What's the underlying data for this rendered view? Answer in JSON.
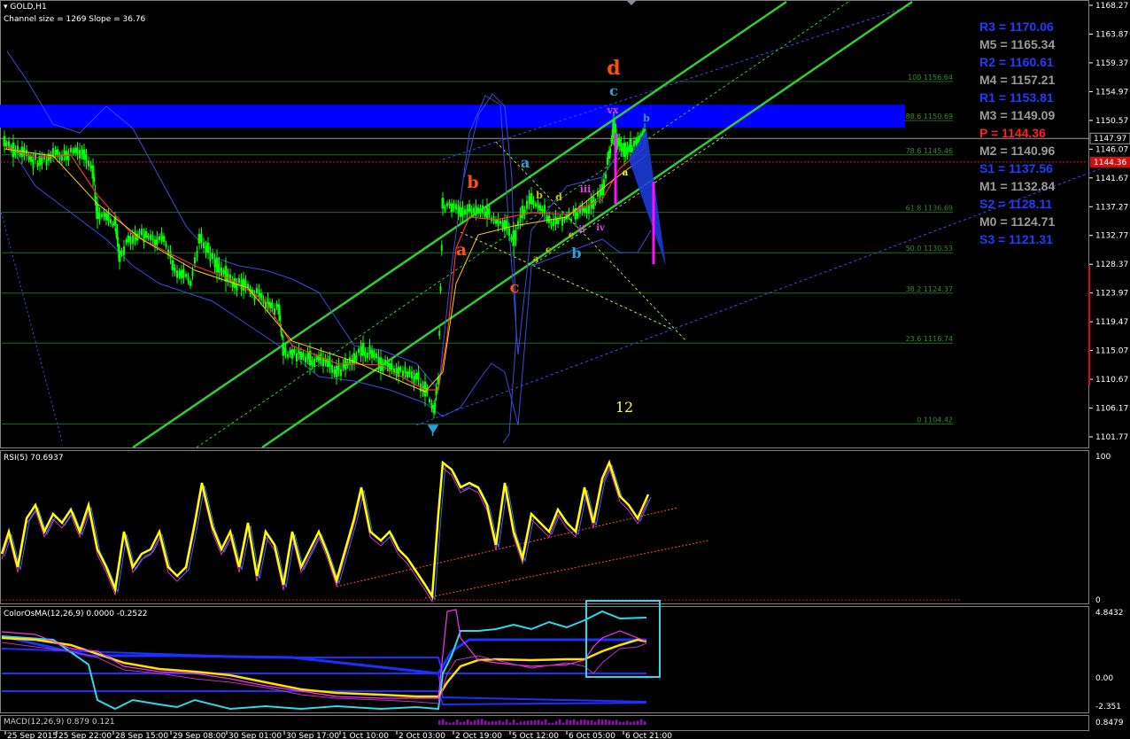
{
  "main_pane": {
    "title": "GOLD,H1",
    "subtitle": "Channel size = 1269 Slope = 36.76",
    "price_axis": [
      "1168.27",
      "1163.87",
      "1159.37",
      "1154.97",
      "1150.57",
      "1146.07",
      "1141.67",
      "1137.27",
      "1132.77",
      "1128.37",
      "1123.97",
      "1119.47",
      "1115.07",
      "1110.67",
      "1106.17",
      "1101.77"
    ],
    "current_price_tag": "1147.97",
    "red_price_tag": "1144.36",
    "pivots": [
      {
        "label": "R3 = 1170.06",
        "color": "#1f3cff"
      },
      {
        "label": "M5 = 1165.34",
        "color": "#9a9a9a"
      },
      {
        "label": "R2 = 1160.61",
        "color": "#1f3cff"
      },
      {
        "label": "M4 = 1157.21",
        "color": "#9a9a9a"
      },
      {
        "label": "R1 = 1153.81",
        "color": "#1f3cff"
      },
      {
        "label": "M3 = 1149.09",
        "color": "#9a9a9a"
      },
      {
        "label": "P  = 1144.36",
        "color": "#ff2020"
      },
      {
        "label": "M2 = 1140.96",
        "color": "#9a9a9a"
      },
      {
        "label": "S1 = 1137.56",
        "color": "#1f3cff"
      },
      {
        "label": "M1 = 1132.84",
        "color": "#9a9a9a"
      },
      {
        "label": "S2 = 1128.11",
        "color": "#1f3cff"
      },
      {
        "label": "M0 = 1124.71",
        "color": "#9a9a9a"
      },
      {
        "label": "S3 = 1121.31",
        "color": "#1f3cff"
      }
    ],
    "fib_levels": [
      "100 1156.64",
      "88.6 1150.69",
      "78.6 1145.46",
      "61.8 1136.69",
      "50.0 1130.53",
      "38.2 1124.37",
      "23.6 1116.74",
      "0 1104.42"
    ],
    "wave_labels": [
      {
        "text": "d",
        "color": "#ff5010"
      },
      {
        "text": "c",
        "color": "#28a0e0"
      },
      {
        "text": "vx",
        "color": "#e040e0"
      },
      {
        "text": "b",
        "color": "#28a0e0"
      },
      {
        "text": "a",
        "color": "#28a0e0"
      },
      {
        "text": "b",
        "color": "#ff5010"
      },
      {
        "text": "b",
        "color": "#c8c800"
      },
      {
        "text": "d",
        "color": "#c8c800"
      },
      {
        "text": "iii",
        "color": "#e040e0"
      },
      {
        "text": "i",
        "color": "#e040e0"
      },
      {
        "text": "a",
        "color": "#ff5010"
      },
      {
        "text": "c",
        "color": "#ff5010"
      },
      {
        "text": "a",
        "color": "#c8c800"
      },
      {
        "text": "c",
        "color": "#c8c800"
      },
      {
        "text": "e",
        "color": "#c8c800"
      },
      {
        "text": "ii",
        "color": "#e040e0"
      },
      {
        "text": "iv",
        "color": "#e040e0"
      },
      {
        "text": "b",
        "color": "#28a0e0"
      },
      {
        "text": "a",
        "color": "#ffff40"
      }
    ],
    "count_label": "12"
  },
  "rsi_pane": {
    "title": "RSI(5) 70.6937",
    "axis": [
      "100",
      "0"
    ]
  },
  "osma_pane": {
    "title": "ColorOsMA(12,26,9) 0.0000 -0.2522",
    "axis": [
      "4.8432",
      "0.00",
      "-2.351"
    ]
  },
  "macd_pane": {
    "title": "MACD(12,26,9) 0.879 0.121",
    "axis": [
      "0.8479"
    ]
  },
  "time_axis": [
    "25 Sep 2015",
    "25 Sep 22:00",
    "28 Sep 15:00",
    "29 Sep 08:00",
    "30 Sep 01:00",
    "30 Sep 17:00",
    "1 Oct 10:00",
    "2 Oct 03:00",
    "2 Oct 19:00",
    "5 Oct 12:00",
    "6 Oct 05:00",
    "6 Oct 21:00"
  ],
  "colors": {
    "candle": "#00ff00",
    "channel": "#32cd32",
    "pivot_band": "#0000ff",
    "rsi_line": "#ffff00",
    "osma_highlight": "#30d8e8"
  }
}
